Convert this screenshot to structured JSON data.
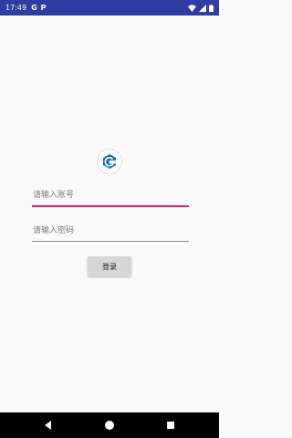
{
  "status_bar": {
    "time": "17:49",
    "notification_icons": [
      "G",
      "P"
    ]
  },
  "login": {
    "account_placeholder": "请输入账号",
    "password_placeholder": "请输入密码",
    "login_label": "登录"
  },
  "colors": {
    "status_bar": "#2f3da3",
    "accent_underline": "#e91e63",
    "button_bg": "#d6d6d6",
    "nav_bar": "#000000"
  }
}
